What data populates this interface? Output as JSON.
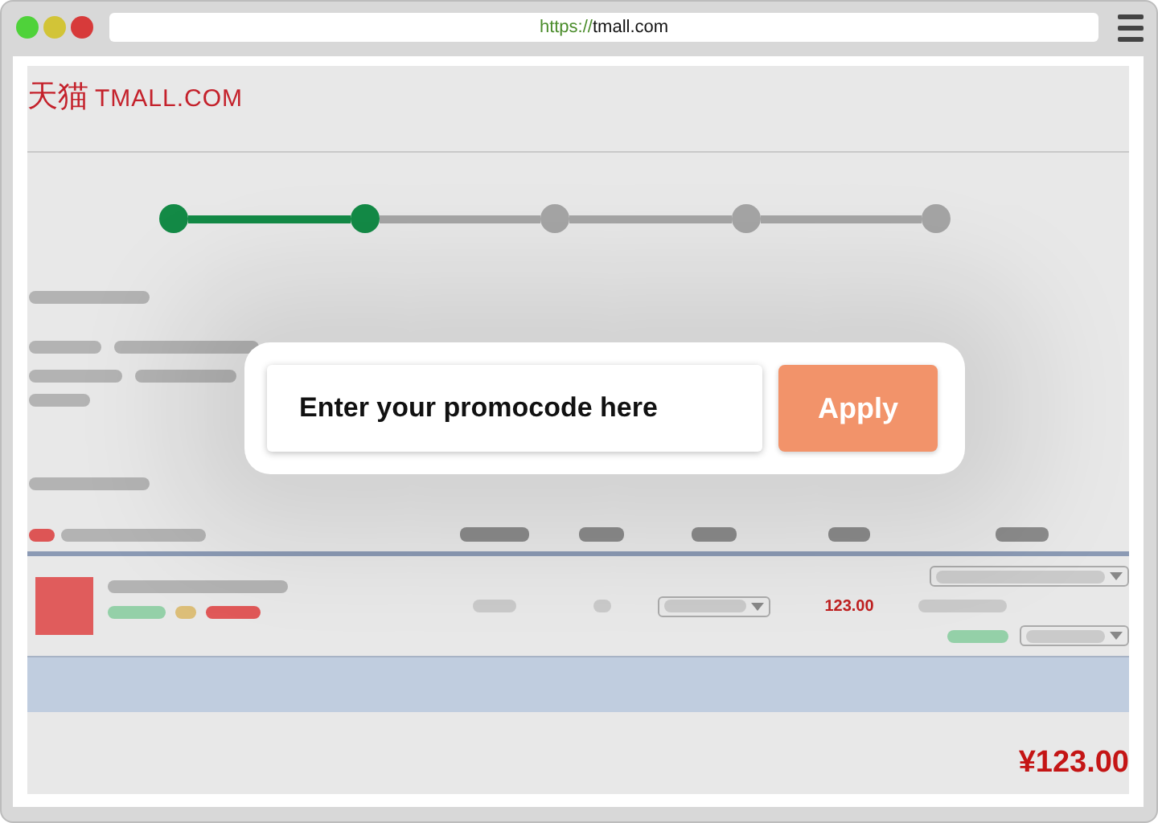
{
  "browser": {
    "url_scheme": "https://",
    "url_host": "tmall.com"
  },
  "logo": {
    "hanzi": "天猫",
    "wordmark": "TMALL.COM"
  },
  "steps": [
    {
      "done": true
    },
    {
      "done": true
    },
    {
      "done": false
    },
    {
      "done": false
    },
    {
      "done": false
    }
  ],
  "promo": {
    "placeholder": "Enter your promocode here",
    "button": "Apply"
  },
  "cart_row": {
    "price": "123.00"
  },
  "total": "¥123.00"
}
